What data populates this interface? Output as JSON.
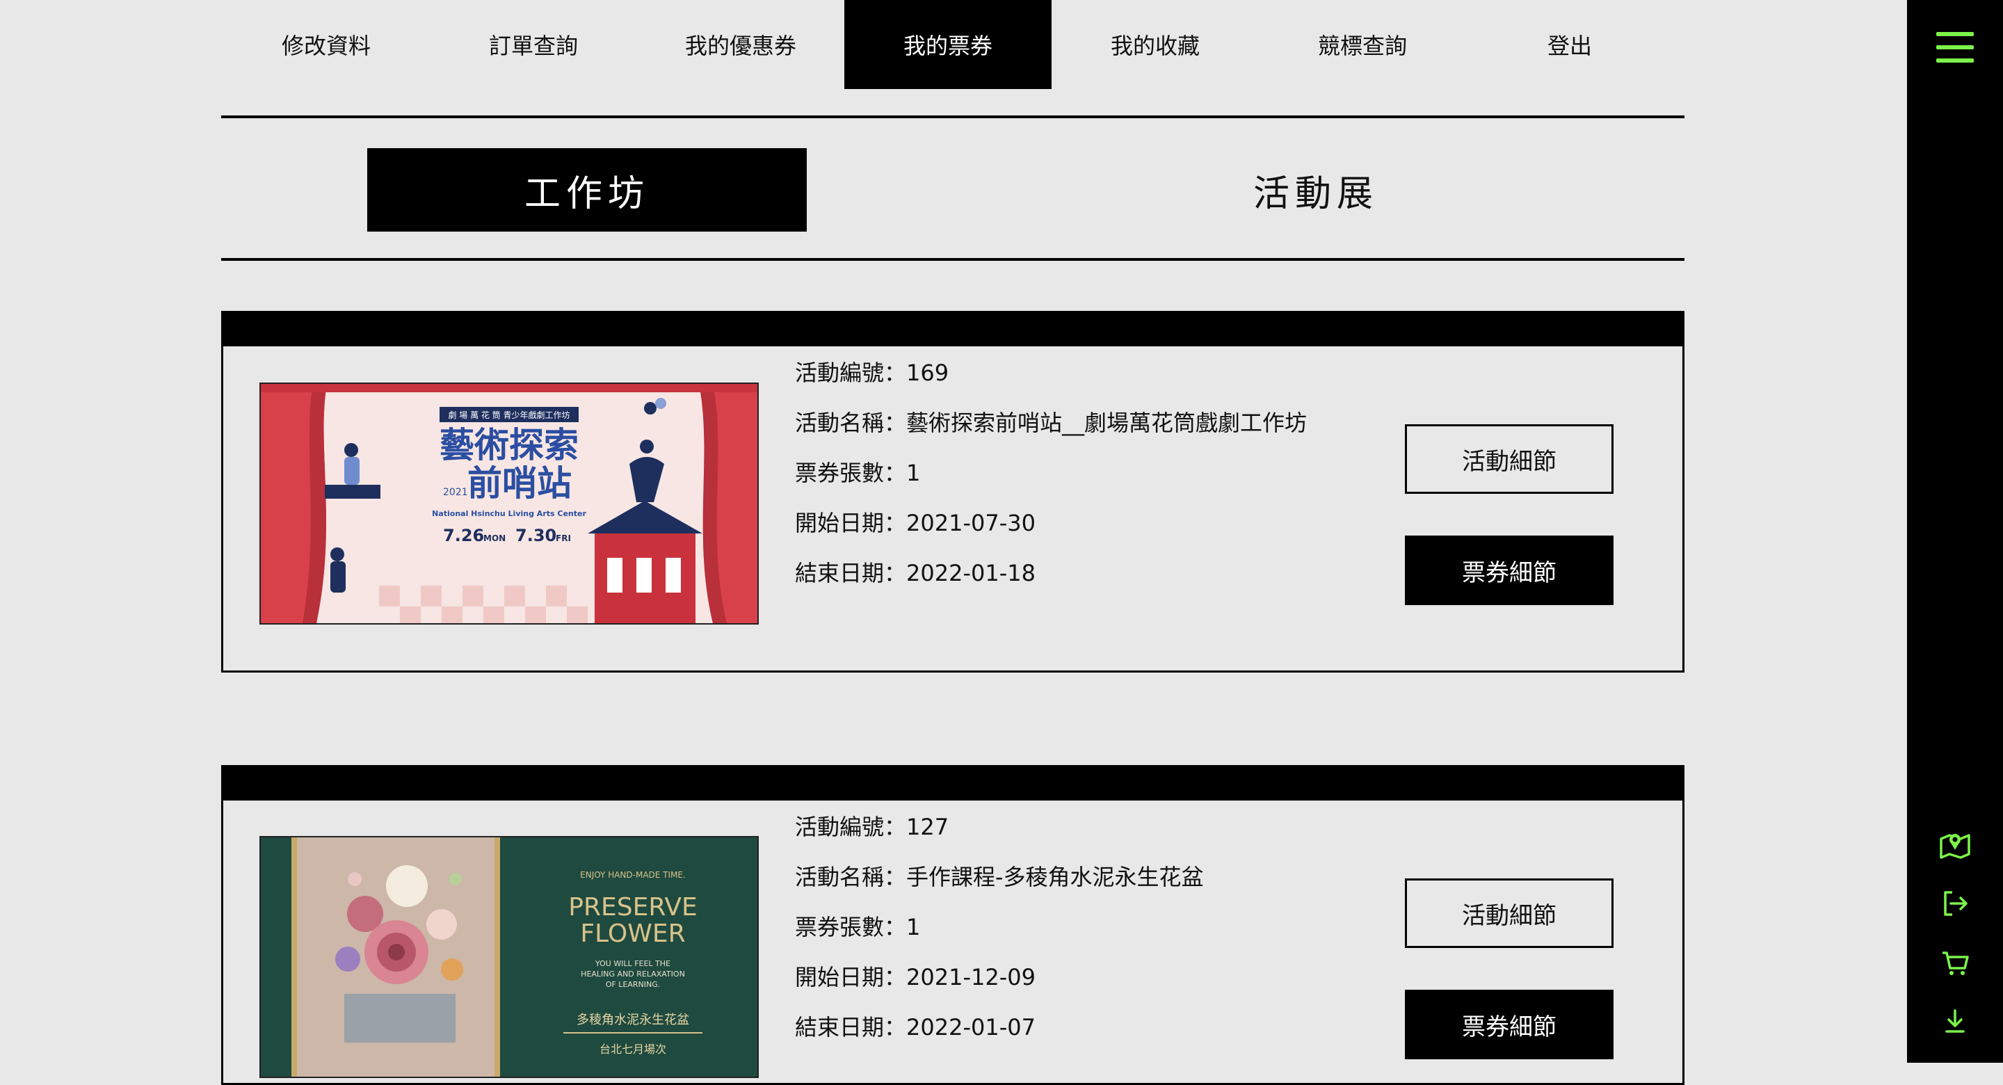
{
  "nav": {
    "items": [
      {
        "label": "修改資料"
      },
      {
        "label": "訂單查詢"
      },
      {
        "label": "我的優惠券"
      },
      {
        "label": "我的票券",
        "active": true
      },
      {
        "label": "我的收藏"
      },
      {
        "label": "競標查詢"
      },
      {
        "label": "登出"
      }
    ]
  },
  "subtabs": [
    {
      "label": "工作坊",
      "active": true
    },
    {
      "label": "活動展",
      "active": false
    }
  ],
  "tickets": [
    {
      "rows": [
        "活動編號：169",
        "活動名稱：藝術探索前哨站__劇場萬花筒戲劇工作坊",
        "票券張數：1",
        "開始日期：2021-07-30",
        "結束日期：2022-01-18"
      ],
      "buttons": {
        "event_detail": "活動細節",
        "ticket_detail": "票券細節"
      },
      "poster": {
        "top_banner": "劇 場 萬 花 筒 青少年戲劇工作坊",
        "title_line1": "藝術探索",
        "title_line2": "前哨站",
        "year": "2021",
        "subtitle": "National Hsinchu Living Arts Center",
        "date_start": "7.26",
        "date_start_day": "MON",
        "date_end": "7.30",
        "date_end_day": "FRI"
      }
    },
    {
      "rows": [
        "活動編號：127",
        "活動名稱：手作課程-多稜角水泥永生花盆",
        "票券張數：1",
        "開始日期：2021-12-09",
        "結束日期：2022-01-07"
      ],
      "buttons": {
        "event_detail": "活動細節",
        "ticket_detail": "票券細節"
      },
      "poster": {
        "tagline": "ENJOY HAND-MADE TIME.",
        "title_line1": "PRESERVE",
        "title_line2": "FLOWER",
        "desc1": "YOU WILL FEEL THE",
        "desc2": "HEALING AND RELAXATION",
        "desc3": "OF LEARNING.",
        "cn_title": "多稜角水泥永生花盆",
        "cn_sub": "台北七月場次"
      }
    }
  ],
  "sidebar": {
    "icons": [
      "menu-icon",
      "map-pin-icon",
      "logout-icon",
      "cart-icon",
      "download-icon"
    ],
    "accent": "#7cf44a"
  }
}
